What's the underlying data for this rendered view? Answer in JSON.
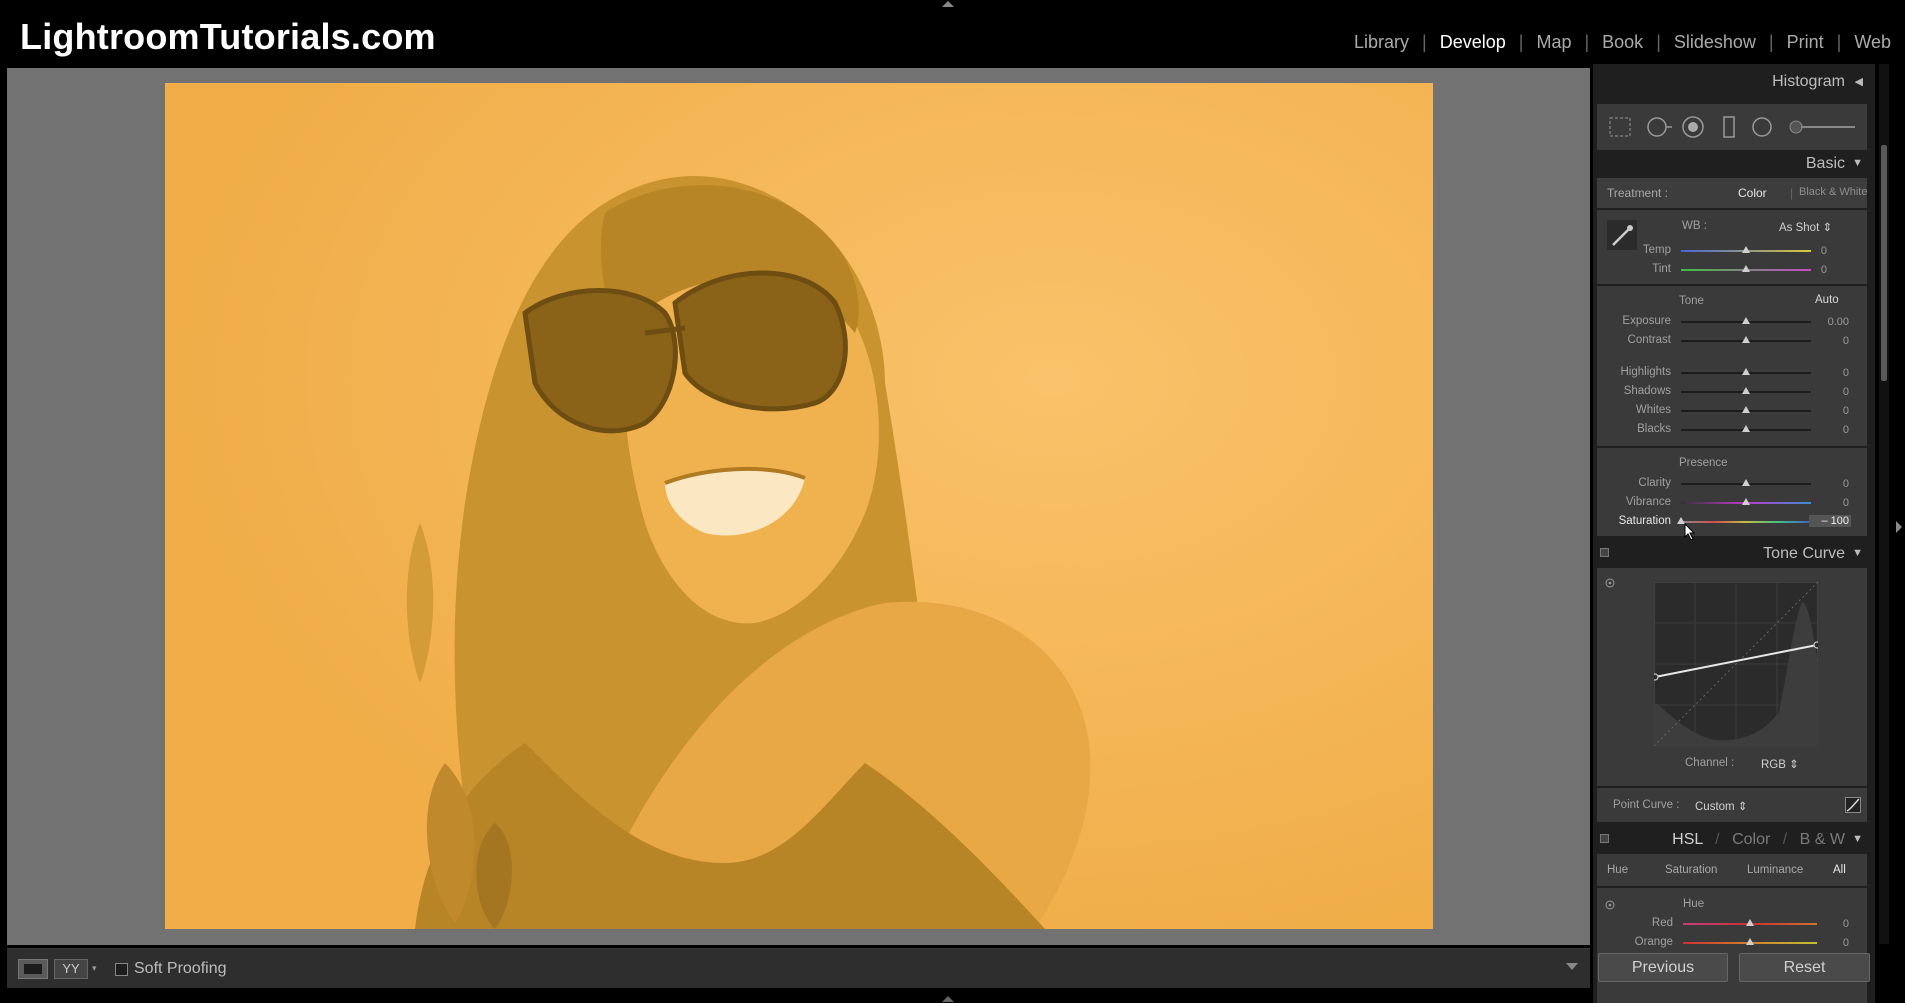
{
  "brand": "LightroomTutorials.com",
  "modules": [
    {
      "label": "Library",
      "active": false
    },
    {
      "label": "Develop",
      "active": true
    },
    {
      "label": "Map",
      "active": false
    },
    {
      "label": "Book",
      "active": false
    },
    {
      "label": "Slideshow",
      "active": false
    },
    {
      "label": "Print",
      "active": false
    },
    {
      "label": "Web",
      "active": false
    }
  ],
  "toolbar": {
    "before_after_glyph": "YY",
    "soft_proofing": "Soft Proofing",
    "soft_proofing_checked": false
  },
  "histogram": {
    "title": "Histogram"
  },
  "tools": [
    "crop-overlay-icon",
    "spot-removal-icon",
    "red-eye-icon",
    "graduated-filter-icon",
    "radial-filter-icon",
    "adjustment-brush-icon"
  ],
  "basic": {
    "title": "Basic",
    "treatment_label": "Treatment :",
    "treatment_options": [
      "Color",
      "Black & White"
    ],
    "treatment_selected": "Color",
    "wb_label": "WB :",
    "wb_value": "As Shot",
    "wb_sliders": [
      {
        "label": "Temp",
        "value": "0",
        "pos": 0.5
      },
      {
        "label": "Tint",
        "value": "0",
        "pos": 0.5
      }
    ],
    "tone_label": "Tone",
    "auto_label": "Auto",
    "tone_sliders": [
      {
        "label": "Exposure",
        "value": "0.00",
        "pos": 0.5
      },
      {
        "label": "Contrast",
        "value": "0",
        "pos": 0.5
      }
    ],
    "tone_sliders2": [
      {
        "label": "Highlights",
        "value": "0",
        "pos": 0.5
      },
      {
        "label": "Shadows",
        "value": "0",
        "pos": 0.5
      },
      {
        "label": "Whites",
        "value": "0",
        "pos": 0.5
      },
      {
        "label": "Blacks",
        "value": "0",
        "pos": 0.5
      }
    ],
    "presence_label": "Presence",
    "presence_sliders": [
      {
        "label": "Clarity",
        "value": "0",
        "pos": 0.5
      },
      {
        "label": "Vibrance",
        "value": "0",
        "pos": 0.5
      },
      {
        "label": "Saturation",
        "value": "– 100",
        "pos": 0.0
      }
    ]
  },
  "tone_curve": {
    "title": "Tone Curve",
    "channel_label": "Channel :",
    "channel_value": "RGB",
    "point_curve_label": "Point Curve :",
    "point_curve_value": "Custom"
  },
  "hsl": {
    "tabs": [
      "HSL",
      "Color",
      "B & W"
    ],
    "sub_tabs": [
      "Hue",
      "Saturation",
      "Luminance",
      "All"
    ],
    "selected_sub_tab": "All",
    "section_label": "Hue",
    "sliders": [
      {
        "label": "Red",
        "value": "0",
        "pos": 0.5
      },
      {
        "label": "Orange",
        "value": "0",
        "pos": 0.5
      }
    ]
  },
  "buttons": {
    "previous": "Previous",
    "reset": "Reset"
  },
  "colors": {
    "photo_tint": "#f4b652",
    "panel_bg": "#3a3a3a",
    "canvas_bg": "#727272"
  }
}
